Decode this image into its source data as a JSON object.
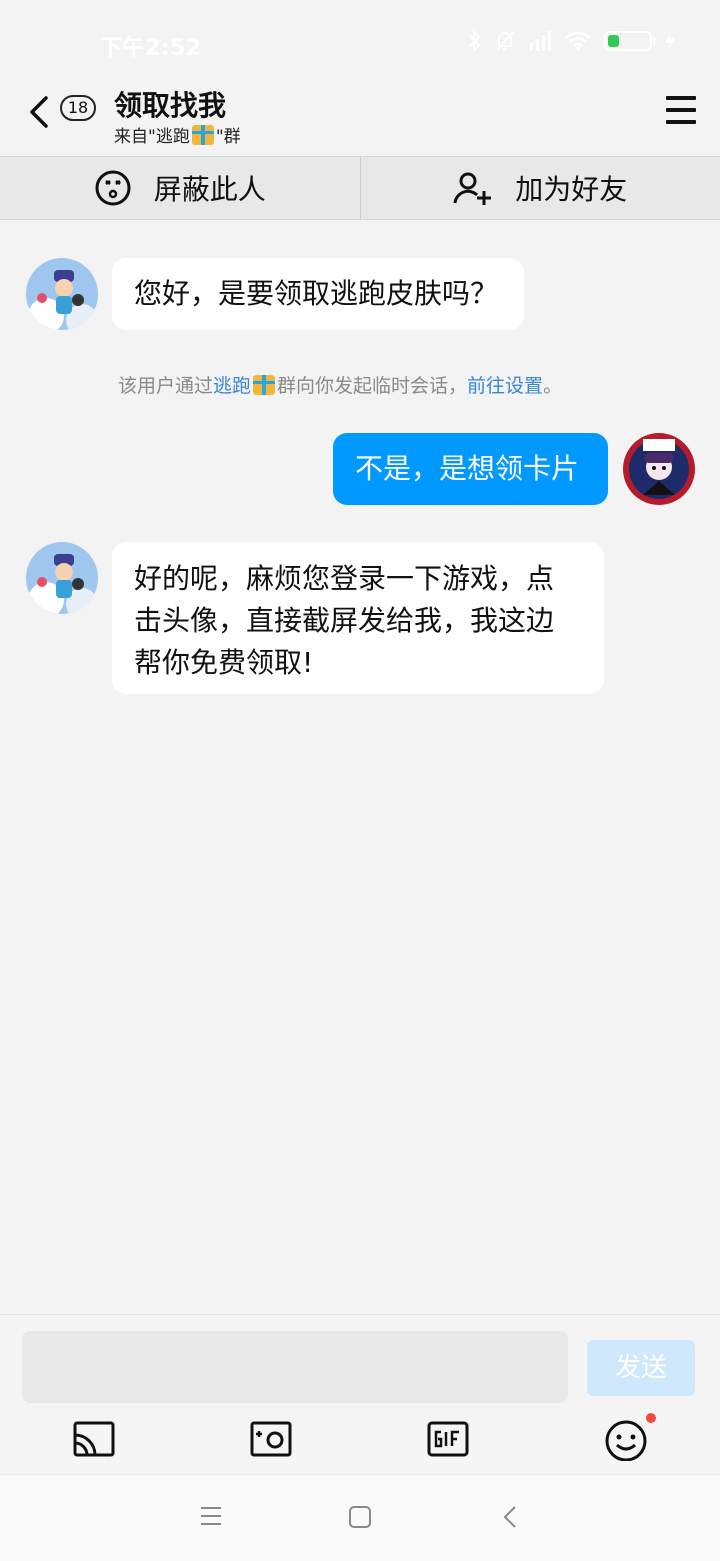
{
  "status_bar": {
    "time": "下午2:52",
    "battery_percent": 25
  },
  "header": {
    "unread_count": "18",
    "title": "领取找我",
    "subtitle_prefix": "来自\"逃跑",
    "subtitle_suffix": "\"群"
  },
  "actions": {
    "block_label": "屏蔽此人",
    "add_friend_label": "加为好友"
  },
  "messages": [
    {
      "direction": "incoming",
      "text": "您好，是要领取逃跑皮肤吗？"
    },
    {
      "direction": "outgoing",
      "text": "不是，是想领卡片"
    },
    {
      "direction": "incoming",
      "lines": [
        "好的呢，麻烦您登录一下游戏，点",
        "击头像，直接截屏发给我，我这边",
        "帮你免费领取!"
      ]
    }
  ],
  "system_note": {
    "prefix": "该用户通过",
    "group_link": "逃跑",
    "middle": "群向你发起临时会话，",
    "settings_link": "前往设置",
    "suffix": "。"
  },
  "composer": {
    "input_value": "",
    "send_label": "发送"
  },
  "colors": {
    "accent": "#0099ff",
    "link": "#3a86d6",
    "background": "#f3f3f4",
    "send_disabled": "#cfe8fc"
  },
  "icons": [
    "back-icon",
    "menu-icon",
    "block-icon",
    "add-friend-icon",
    "screen-cast-icon",
    "camera-icon",
    "gif-icon",
    "emoji-icon",
    "nav-menu-icon",
    "nav-home-icon",
    "nav-back-icon"
  ]
}
